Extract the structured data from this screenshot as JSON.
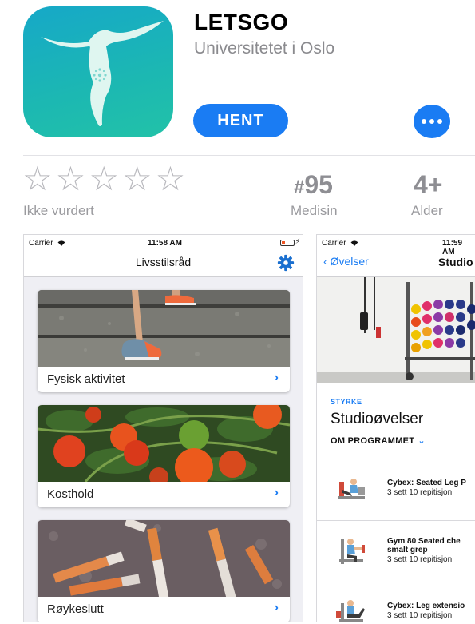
{
  "app": {
    "name": "LETSGO",
    "developer": "Universitetet i Oslo",
    "get_label": "HENT",
    "brand_color": "#1a7cf3",
    "icon_colors": [
      "#16a8c8",
      "#22c2a8"
    ]
  },
  "ratings": {
    "stars_filled": 0,
    "stars_total": 5,
    "star_glyph": "☆",
    "label": "Ikke vurdert"
  },
  "rank": {
    "hash": "#",
    "value": "95",
    "label": "Medisin"
  },
  "age": {
    "value": "4+",
    "label": "Alder"
  },
  "screenshot1": {
    "carrier": "Carrier",
    "time": "11:58 AM",
    "title": "Livsstilsråd",
    "cards": [
      {
        "label": "Fysisk aktivitet"
      },
      {
        "label": "Kosthold"
      },
      {
        "label": "Røykeslutt"
      }
    ],
    "chevron": "›"
  },
  "screenshot2": {
    "carrier": "Carrier",
    "time": "11:59 AM",
    "back_label": "‹ Øvelser",
    "title": "Studio",
    "category": "STYRKE",
    "program_title": "Studioøvelser",
    "about_label": "OM PROGRAMMET",
    "about_chevron": "⌄",
    "exercises": [
      {
        "name_line1": "Cybex: Seated Leg P",
        "name_line2": "",
        "meta": "3 sett   10 repitisjon"
      },
      {
        "name_line1": "Gym 80 Seated che",
        "name_line2": "smalt grep",
        "meta": "3 sett   10 repitisjon"
      },
      {
        "name_line1": "Cybex: Leg extensio",
        "name_line2": "",
        "meta": "3 sett   10 repitisjon"
      }
    ]
  }
}
